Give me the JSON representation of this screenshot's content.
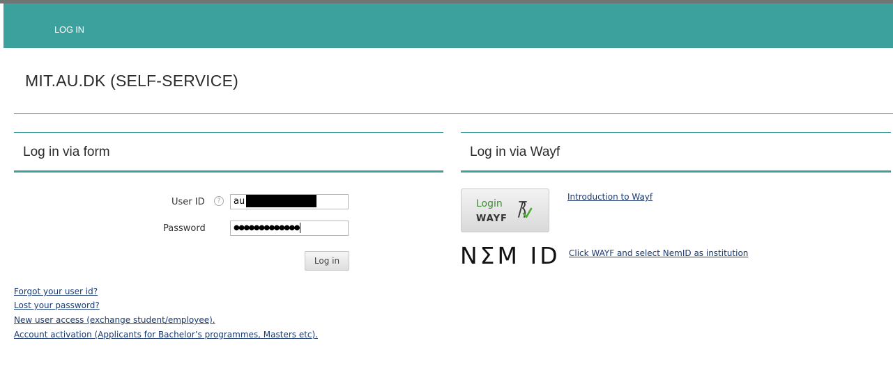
{
  "nav": {
    "login_link": "LOG IN"
  },
  "page": {
    "title": "MIT.AU.DK (SELF-SERVICE)"
  },
  "form_panel": {
    "title": "Log in via form",
    "user_id_label": "User ID",
    "user_id_help": "?",
    "user_id_value": "au",
    "password_label": "Password",
    "password_value": "●●●●●●●●●●●●●",
    "submit_label": "Log in"
  },
  "links": {
    "forgot_user_id": "Forgot your user id?",
    "lost_password": "Lost your password?",
    "new_user_access": "New user access (exchange student/employee).",
    "account_activation": "Account activation (Applicants for Bachelor’s programmes, Masters etc)."
  },
  "wayf_panel": {
    "title": "Log in via Wayf",
    "button_login": "Login",
    "button_wayf": "WAYF",
    "intro_link": "Introduction to Wayf",
    "nemid_logo_text": "NΣM ID",
    "nemid_link": "Click WAYF and select NemID as institution"
  },
  "colors": {
    "accent": "#3ca19c",
    "link": "#1a3a70",
    "wayf_green": "#3d8c30"
  }
}
